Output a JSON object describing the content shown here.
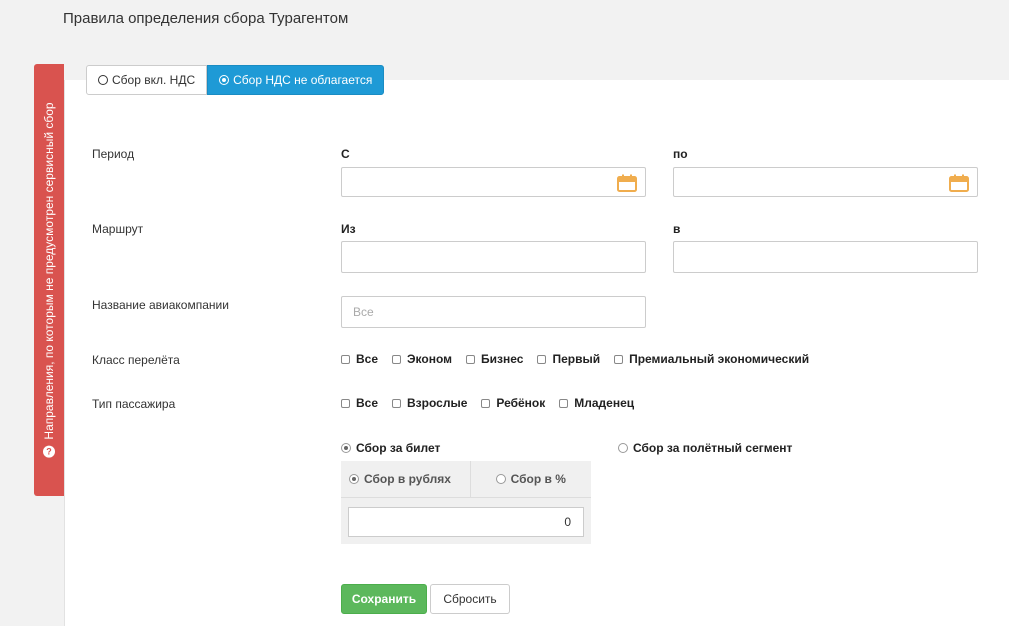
{
  "page": {
    "title": "Правила определения сбора Турагентом"
  },
  "side_tab": {
    "label": "Направления, по которым не предусмотрен сервисный сбор",
    "icon": "help-icon"
  },
  "vat_tabs": [
    {
      "label": "Сбор вкл. НДС",
      "selected": false
    },
    {
      "label": "Сбор НДС не облагается",
      "selected": true
    }
  ],
  "period": {
    "label": "Период",
    "from_label": "С",
    "to_label": "по",
    "from_value": "",
    "to_value": ""
  },
  "route": {
    "label": "Маршрут",
    "from_label": "Из",
    "to_label": "в",
    "from_value": "",
    "to_value": ""
  },
  "airline": {
    "label": "Название авиакомпании",
    "placeholder": "Все",
    "value": ""
  },
  "flight_class": {
    "label": "Класс перелёта",
    "options": [
      "Все",
      "Эконом",
      "Бизнес",
      "Первый",
      "Премиальный экономический"
    ]
  },
  "passenger_type": {
    "label": "Тип пассажира",
    "options": [
      "Все",
      "Взрослые",
      "Ребёнок",
      "Младенец"
    ]
  },
  "fee_mode": {
    "per_ticket": {
      "label": "Сбор за билет",
      "selected": true
    },
    "per_segment": {
      "label": "Сбор за полётный сегмент",
      "selected": false
    }
  },
  "fee_unit": {
    "rubles": {
      "label": "Сбор в рублях",
      "selected": true
    },
    "percent": {
      "label": "Сбор в %",
      "selected": false
    },
    "amount": "0"
  },
  "actions": {
    "save": "Сохранить",
    "reset": "Сбросить"
  },
  "colors": {
    "accent": "#1e9ad6",
    "danger": "#d9534f",
    "success": "#5cb85c",
    "calendar": "#f0ad4e"
  }
}
